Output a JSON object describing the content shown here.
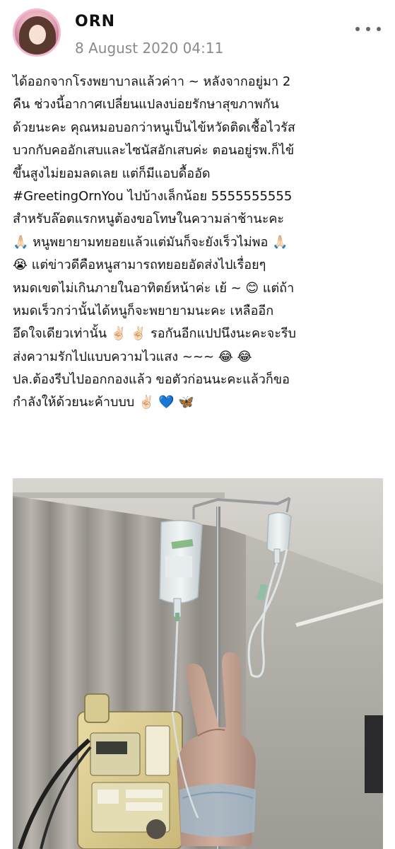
{
  "post": {
    "author": "ORN",
    "timestamp": "8 August 2020 04:11",
    "body_lines": [
      "ได้ออกจากโรงพยาบาลแล้วค่าา ~ หลังจากอยู่มา 2",
      "คืน ช่วงนี้อากาศเปลี่ยนแปลงบ่อยรักษาสุขภาพกัน",
      "ด้วยนะคะ คุณหมอบอกว่าหนูเป็นไข้หวัดติดเชื้อไวรัส",
      "บวกกับคออักเสบและไซนัสอักเสบค่ะ ตอนอยู่รพ.ก็ไข้",
      "ขึ้นสูงไม่ยอมลดเลย แต่ก็มีแอบดื้ออัด",
      "#GreetingOrnYou ไปบ้างเล็กน้อย 5555555555",
      "สำหรับล๊อตแรกหนูต้องขอโทษในความล่าช้านะคะ",
      "🙏🏻 หนูพยายามทยอยแล้วแต่มันก็จะยังเร็วไม่พอ 🙏🏻",
      "😭 แต่ข่าวดีคือหนูสามารถทยอยอัดส่งไปเรื่อยๆ",
      "หมดเขตไม่เกินภายในอาทิตย์หน้าค่ะ เย้ ~ 😊 แต่ถ้า",
      "หมดเร็วกว่านั้นได้หนูก็จะพยายามนะคะ เหลืออีก",
      "อึดใจเดียวเท่านั้น ✌🏻 ✌🏻 รอกันอีกแปปนึงนะคะจะรีบ",
      "ส่งความรักไปแบบความไวแสง ~~~ 😂 😂",
      "ปล.ต้องรีบไปออกกองแล้ว ขอตัวก่อนนะคะแล้วก็ขอ",
      "กำลังให้ด้วยนะค้าบบบ ✌🏻 💙 🦋"
    ]
  },
  "icons": {
    "more": "more-options-icon",
    "avatar": "profile-avatar"
  },
  "colors": {
    "timestamp": "#8a8a8a",
    "avatar_ring": "#f3b9d1"
  }
}
